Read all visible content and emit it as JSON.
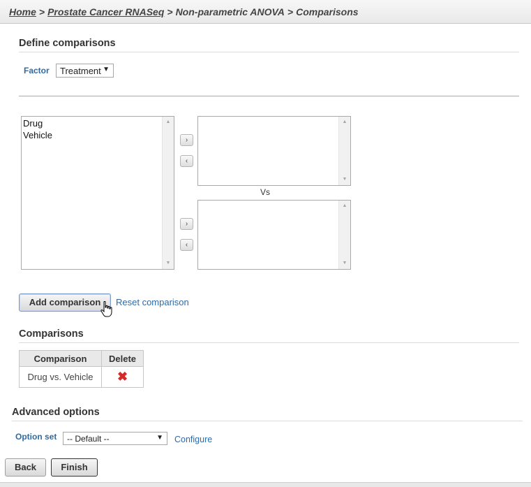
{
  "breadcrumb": {
    "home": "Home",
    "project": "Prostate Cancer RNASeq",
    "task": "Non-parametric ANOVA",
    "current": "Comparisons",
    "separator": ">"
  },
  "define": {
    "title": "Define comparisons",
    "factor_label": "Factor",
    "factor_value": "Treatment",
    "factor_arrow": "▼"
  },
  "lists": {
    "source_items": [
      "Drug",
      "Vehicle"
    ],
    "vs_label": "Vs",
    "add_right_label": "›",
    "remove_left_label": "‹"
  },
  "actions": {
    "add_comparison": "Add comparison",
    "reset_comparison": "Reset comparison"
  },
  "comparisons": {
    "title": "Comparisons",
    "headers": [
      "Comparison",
      "Delete"
    ],
    "rows": [
      {
        "comparison": "Drug vs. Vehicle",
        "delete_icon": "x-icon"
      }
    ]
  },
  "advanced": {
    "title": "Advanced options",
    "option_set_label": "Option set",
    "option_set_value": "-- Default --",
    "option_set_arrow": "▼",
    "configure": "Configure"
  },
  "footer": {
    "back": "Back",
    "finish": "Finish"
  },
  "colors": {
    "link_blue": "#2f6aa3",
    "delete_red": "#d42a2a"
  }
}
